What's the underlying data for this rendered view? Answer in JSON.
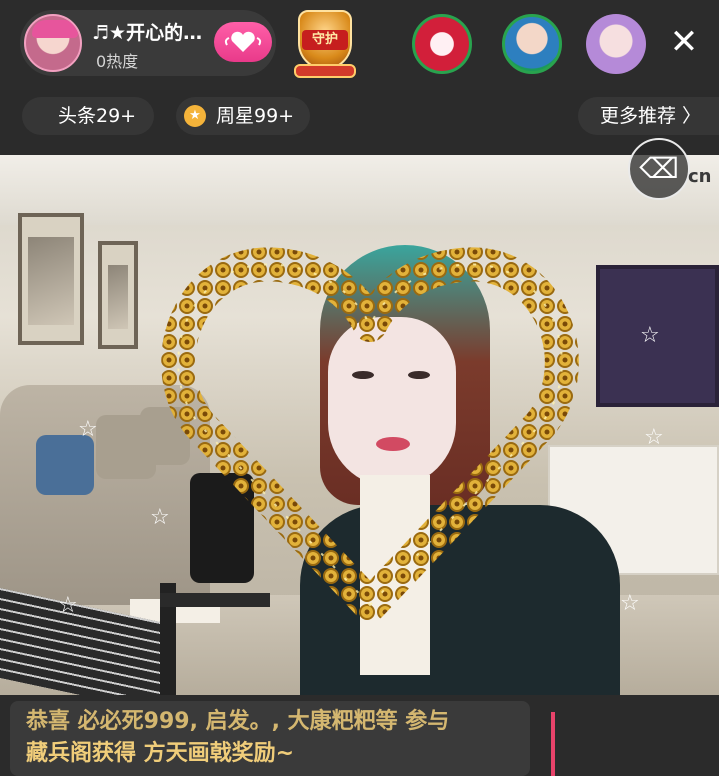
{
  "top_bar": {
    "host": {
      "name": "♬★开心的…",
      "heat": "0热度",
      "avatar_icon": "host-avatar"
    },
    "follow_icon": "heart-wings-icon",
    "guard_badge": {
      "label": "守护"
    },
    "close_icon": "close-icon",
    "close_glyph": "✕",
    "fan_avatars": [
      "fan-avatar-heart",
      "fan-avatar-girl",
      "fan-avatar-purple"
    ]
  },
  "secondary_bar": {
    "headline": "头条29+",
    "weekly_star": "周星99+",
    "more": "更多推荐 〉"
  },
  "video": {
    "overlay_effect": "gold-heart-frame",
    "cleaner_icon": "broom-icon",
    "watermark_fragment": "cn"
  },
  "chat": {
    "line1": "恭喜 必必死999, 启发。, 大康粑粑等 参与",
    "line2": "藏兵阁获得 方天画戟奖励~"
  },
  "colors": {
    "background": "#2b2b2b",
    "accent_pink": "#e93a8a",
    "chat_text": "#f0cd7a",
    "indicator": "#e8436a",
    "heart_gold": "#e2b23a"
  }
}
